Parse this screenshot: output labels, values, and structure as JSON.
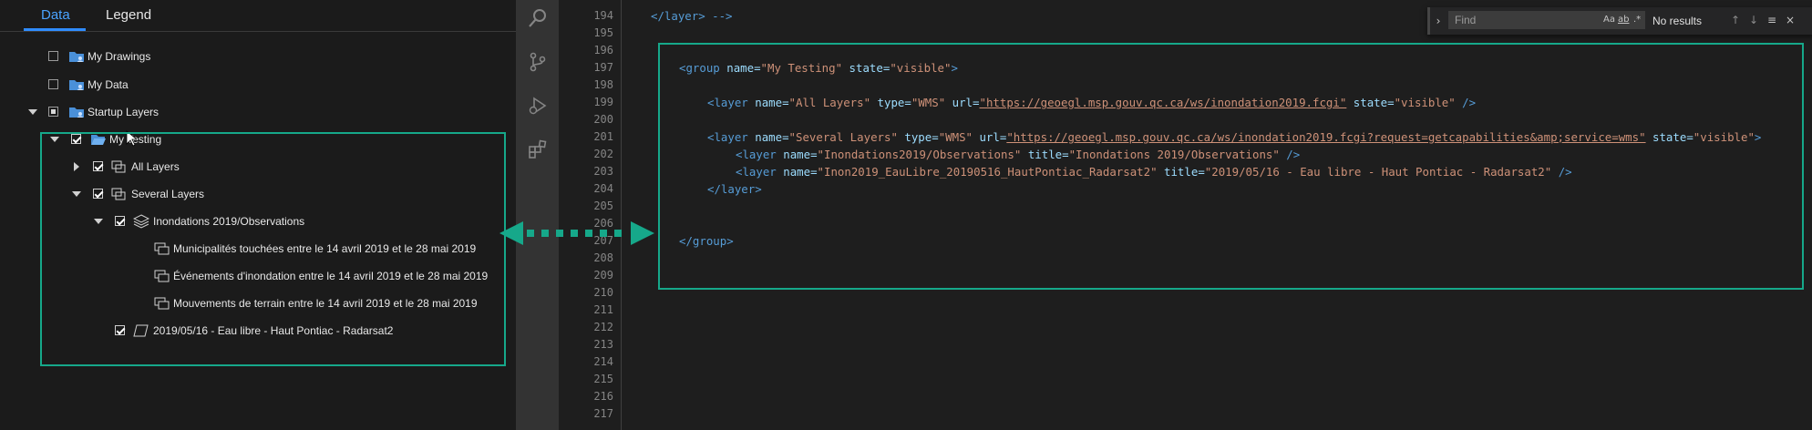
{
  "layer_panel": {
    "tabs": [
      {
        "label": "Data",
        "active": true
      },
      {
        "label": "Legend",
        "active": false
      }
    ],
    "tree": [
      {
        "label": "My Drawings",
        "checked": false,
        "icon": "folder-user-icon"
      },
      {
        "label": "My Data",
        "checked": false,
        "icon": "folder-user-icon"
      },
      {
        "label": "Startup Layers",
        "checked": "partial",
        "icon": "folder-user-icon",
        "expanded": true
      },
      {
        "label": "My Testing",
        "checked": true,
        "icon": "folder-open-icon",
        "expanded": true
      },
      {
        "label": "All Layers",
        "checked": true,
        "icon": "layer-group-icon",
        "expanded": false
      },
      {
        "label": "Several Layers",
        "checked": true,
        "icon": "layer-group-icon",
        "expanded": true
      },
      {
        "label": "Inondations 2019/Observations",
        "checked": true,
        "icon": "layers-stack-icon",
        "expanded": true
      },
      {
        "label": "Municipalités touchées entre le 14 avril 2019 et le 28 mai 2019",
        "icon": "sublayer-icon"
      },
      {
        "label": "Événements d'inondation entre le 14 avril 2019 et le 28 mai 2019",
        "icon": "sublayer-icon"
      },
      {
        "label": "Mouvements de terrain entre le 14 avril 2019 et le 28 mai 2019",
        "icon": "sublayer-icon"
      },
      {
        "label": "2019/05/16 - Eau libre - Haut Pontiac - Radarsat2",
        "checked": true,
        "icon": "raster-layer-icon"
      }
    ]
  },
  "editor": {
    "find": {
      "placeholder": "Find",
      "match_case": "Aa",
      "whole_word": "ab",
      "regex": ".*",
      "results": "No results",
      "prev": "↑",
      "next": "↓",
      "selection": "≡",
      "close": "×"
    },
    "line_numbers": [
      "194",
      "195",
      "196",
      "197",
      "198",
      "199",
      "200",
      "201",
      "202",
      "203",
      "204",
      "205",
      "206",
      "207",
      "208",
      "209",
      "210",
      "211",
      "212",
      "213",
      "214",
      "215",
      "216",
      "217"
    ],
    "code": {
      "l194": "</layer> -->",
      "l197_tag": "<group",
      "l197_a1": "name=",
      "l197_v1": "\"My Testing\"",
      "l197_a2": "state=",
      "l197_v2": "\"visible\"",
      "l197_end": ">",
      "l199_tag": "<layer",
      "l199_a1": "name=",
      "l199_v1": "\"All Layers\"",
      "l199_a2": "type=",
      "l199_v2": "\"WMS\"",
      "l199_a3": "url=",
      "l199_v3": "\"https://geoegl.msp.gouv.qc.ca/ws/inondation2019.fcgi\"",
      "l199_a4": "state=",
      "l199_v4": "\"visible\"",
      "l199_end": " />",
      "l201_tag": "<layer",
      "l201_a1": "name=",
      "l201_v1": "\"Several Layers\"",
      "l201_a2": "type=",
      "l201_v2": "\"WMS\"",
      "l201_a3": "url=",
      "l201_v3": "\"https://geoegl.msp.gouv.qc.ca/ws/inondation2019.fcgi?request=getcapabilities&amp;service=wms\"",
      "l201_a4": "state=",
      "l201_v4": "\"visible\"",
      "l201_end": ">",
      "l202_tag": "<layer",
      "l202_a1": "name=",
      "l202_v1": "\"Inondations2019/Observations\"",
      "l202_a2": "title=",
      "l202_v2": "\"Inondations 2019/Observations\"",
      "l202_end": " />",
      "l203_tag": "<layer",
      "l203_a1": "name=",
      "l203_v1": "\"Inon2019_EauLibre_20190516_HautPontiac_Radarsat2\"",
      "l203_a2": "title=",
      "l203_v2": "\"2019/05/16 - Eau libre - Haut Pontiac - Radarsat2\"",
      "l203_end": " />",
      "l204": "</layer>",
      "l207": "</group>"
    }
  },
  "colors": {
    "highlight": "#16a88a",
    "accent": "#2f8cff"
  }
}
